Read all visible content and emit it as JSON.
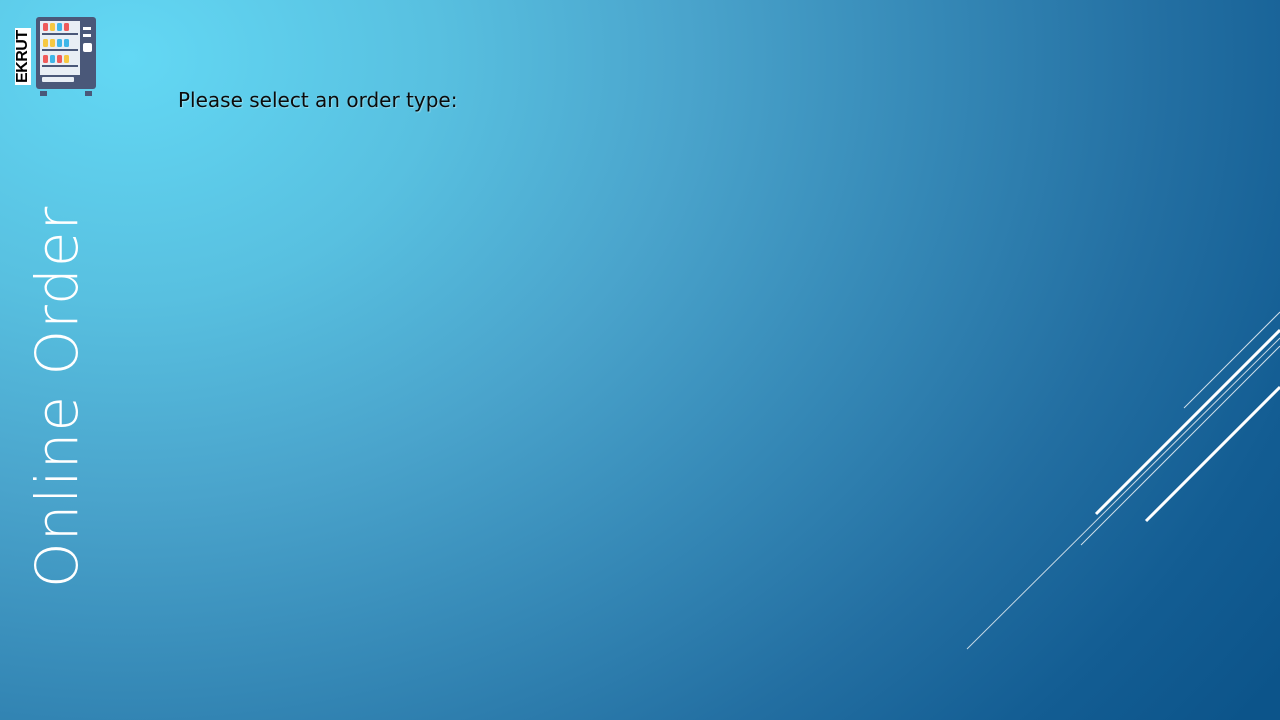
{
  "logo": {
    "text": "EKRUT"
  },
  "page": {
    "side_title": "Online Order",
    "prompt": "Please select an order type:"
  },
  "colors": {
    "background_light": "#63d8f4",
    "background_dark": "#0c548a",
    "title_text": "#ffffff",
    "prompt_text": "#0b0b0b",
    "machine_body": "#4a5879"
  },
  "icons": {
    "logo": "vending-machine-icon"
  }
}
